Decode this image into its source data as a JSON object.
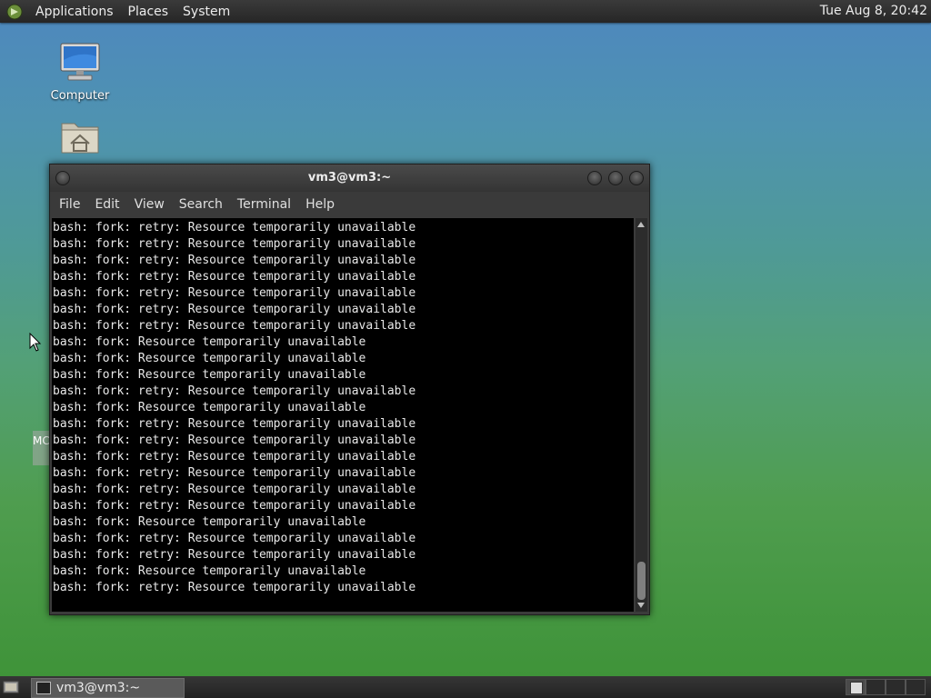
{
  "top_panel": {
    "menus": [
      "Applications",
      "Places",
      "System"
    ],
    "clock": "Tue Aug  8, 20:42"
  },
  "desktop": {
    "icons": [
      {
        "label": "Computer"
      },
      {
        "label": ""
      }
    ],
    "partial_icon_text": "MC"
  },
  "terminal_window": {
    "title": "vm3@vm3:~",
    "menu": [
      "File",
      "Edit",
      "View",
      "Search",
      "Terminal",
      "Help"
    ],
    "lines": [
      "bash: fork: retry: Resource temporarily unavailable",
      "bash: fork: retry: Resource temporarily unavailable",
      "bash: fork: retry: Resource temporarily unavailable",
      "bash: fork: retry: Resource temporarily unavailable",
      "bash: fork: retry: Resource temporarily unavailable",
      "bash: fork: retry: Resource temporarily unavailable",
      "bash: fork: retry: Resource temporarily unavailable",
      "bash: fork: Resource temporarily unavailable",
      "bash: fork: Resource temporarily unavailable",
      "bash: fork: Resource temporarily unavailable",
      "bash: fork: retry: Resource temporarily unavailable",
      "bash: fork: Resource temporarily unavailable",
      "bash: fork: retry: Resource temporarily unavailable",
      "bash: fork: retry: Resource temporarily unavailable",
      "bash: fork: retry: Resource temporarily unavailable",
      "bash: fork: retry: Resource temporarily unavailable",
      "bash: fork: retry: Resource temporarily unavailable",
      "bash: fork: retry: Resource temporarily unavailable",
      "bash: fork: Resource temporarily unavailable",
      "bash: fork: retry: Resource temporarily unavailable",
      "bash: fork: retry: Resource temporarily unavailable",
      "bash: fork: Resource temporarily unavailable",
      "bash: fork: retry: Resource temporarily unavailable"
    ]
  },
  "bottom_panel": {
    "task_label": "vm3@vm3:~"
  },
  "icons": {
    "menu_logo": "mint-logo-icon",
    "computer": "computer-icon",
    "home": "home-folder-icon",
    "show_desktop": "show-desktop-icon",
    "terminal_task": "terminal-icon"
  },
  "colors": {
    "panel": "#2e2e2e",
    "terminal_bg": "#000000",
    "terminal_fg": "#e8e8e8"
  }
}
